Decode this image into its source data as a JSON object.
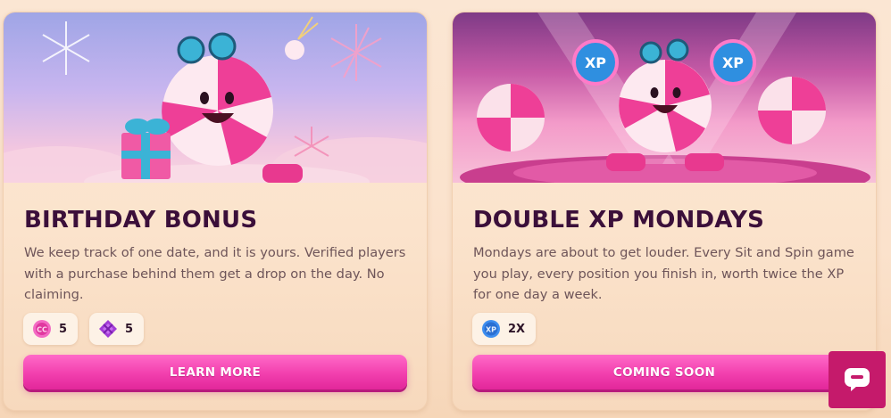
{
  "cards": [
    {
      "title": "BIRTHDAY BONUS",
      "description": "We keep track of one date, and it is yours. Verified players with a purchase behind them get a drop on the day. No claiming.",
      "rewards": [
        {
          "icon": "gold-coin-icon",
          "value": "5"
        },
        {
          "icon": "purple-gem-icon",
          "value": "5"
        }
      ],
      "button_label": "LEARN MORE",
      "hero_art": "candy-mascot-with-gift-and-fireworks"
    },
    {
      "title": "DOUBLE XP MONDAYS",
      "description": "Mondays are about to get louder. Every Sit and Spin game you play, every position you finish in, worth twice the XP for one day a week.",
      "rewards": [
        {
          "icon": "xp-badge-icon",
          "value": "2X"
        }
      ],
      "button_label": "COMING SOON",
      "hero_art": "candy-mascot-holding-xp-signs-in-arena"
    }
  ],
  "colors": {
    "title": "#3b0f3a",
    "body_text": "#6e5559",
    "button_pink": "#f23fae",
    "chat_button": "#c51a6b"
  },
  "chat_widget": {
    "icon": "chat-bubble-icon"
  }
}
